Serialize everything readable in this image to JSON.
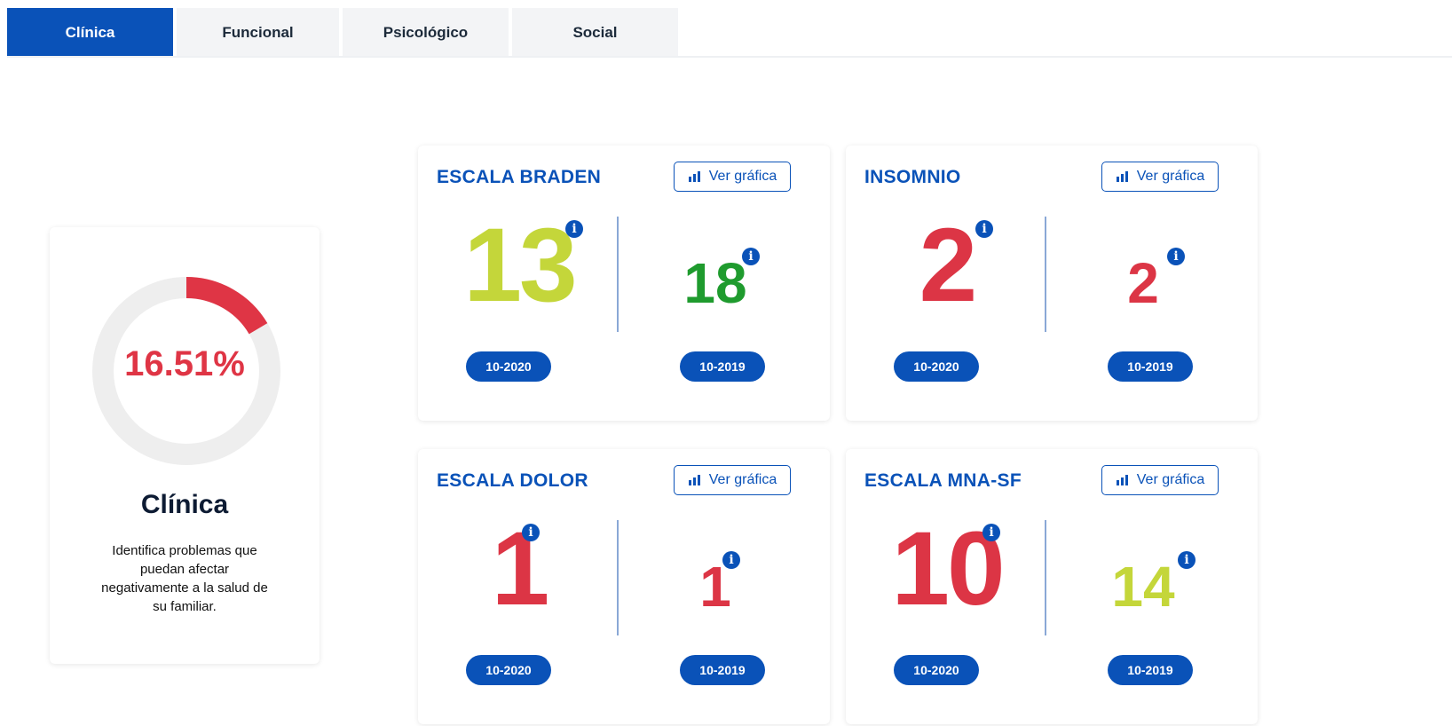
{
  "tabs": [
    {
      "label": "Clínica",
      "active": true
    },
    {
      "label": "Funcional",
      "active": false
    },
    {
      "label": "Psicológico",
      "active": false
    },
    {
      "label": "Social",
      "active": false
    }
  ],
  "summary": {
    "percent_label": "16.51%",
    "percent_value": 16.51,
    "title": "Clínica",
    "description": "Identifica problemas que puedan afectar negativamente a la salud de su familiar."
  },
  "chart_button_label": "Ver gráfica",
  "cards": [
    {
      "title": "ESCALA BRADEN",
      "current": {
        "value": "13",
        "date": "10-2020",
        "color": "#c4d63a"
      },
      "previous": {
        "value": "18",
        "date": "10-2019",
        "color": "#1f9b2e"
      }
    },
    {
      "title": "INSOMNIO",
      "current": {
        "value": "2",
        "date": "10-2020",
        "color": "#dc3545"
      },
      "previous": {
        "value": "2",
        "date": "10-2019",
        "color": "#dc3545"
      }
    },
    {
      "title": "ESCALA DOLOR",
      "current": {
        "value": "1",
        "date": "10-2020",
        "color": "#dc3545"
      },
      "previous": {
        "value": "1",
        "date": "10-2019",
        "color": "#dc3545"
      }
    },
    {
      "title": "ESCALA MNA-SF",
      "current": {
        "value": "10",
        "date": "10-2020",
        "color": "#dc3545"
      },
      "previous": {
        "value": "14",
        "date": "10-2019",
        "color": "#c4d63a"
      }
    }
  ],
  "colors": {
    "primary": "#0a52b8",
    "donut_track": "#eeeeee",
    "donut_fill": "#df3545"
  }
}
